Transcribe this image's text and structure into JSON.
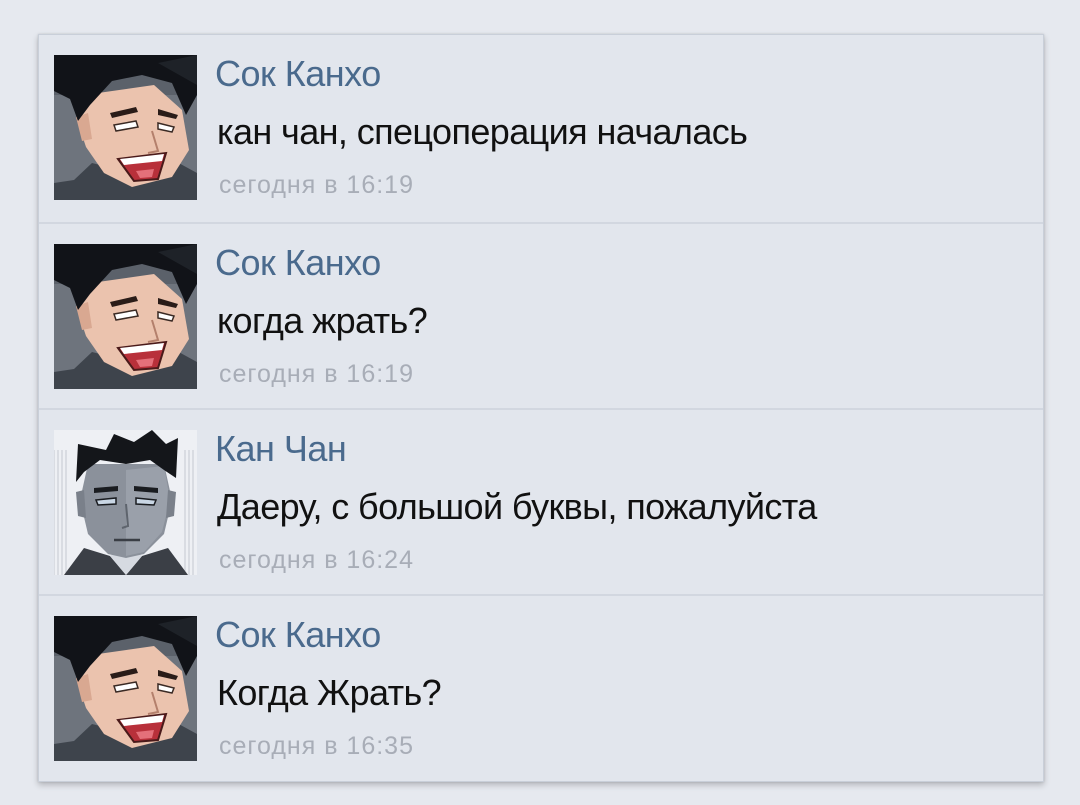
{
  "messages": [
    {
      "author": "Сок Канхо",
      "text": "кан чан, спецоперация началась",
      "time": "сегодня в 16:19",
      "avatar_icon": "laughing-man-avatar-icon"
    },
    {
      "author": "Сок Канхо",
      "text": "когда жрать?",
      "time": "сегодня в 16:19",
      "avatar_icon": "laughing-man-avatar-icon"
    },
    {
      "author": "Кан Чан",
      "text": "Даеру, с большой буквы, пожалуйста",
      "time": "сегодня в 16:24",
      "avatar_icon": "serious-man-avatar-icon"
    },
    {
      "author": "Сок Канхо",
      "text": "Когда Жрать?",
      "time": "сегодня в 16:35",
      "avatar_icon": "laughing-man-avatar-icon"
    }
  ],
  "colors": {
    "background": "#e6e9ef",
    "panel": "#e2e6ed",
    "author_name": "#4a6a8d",
    "message_text": "#111111",
    "timestamp": "#a8adb7"
  }
}
